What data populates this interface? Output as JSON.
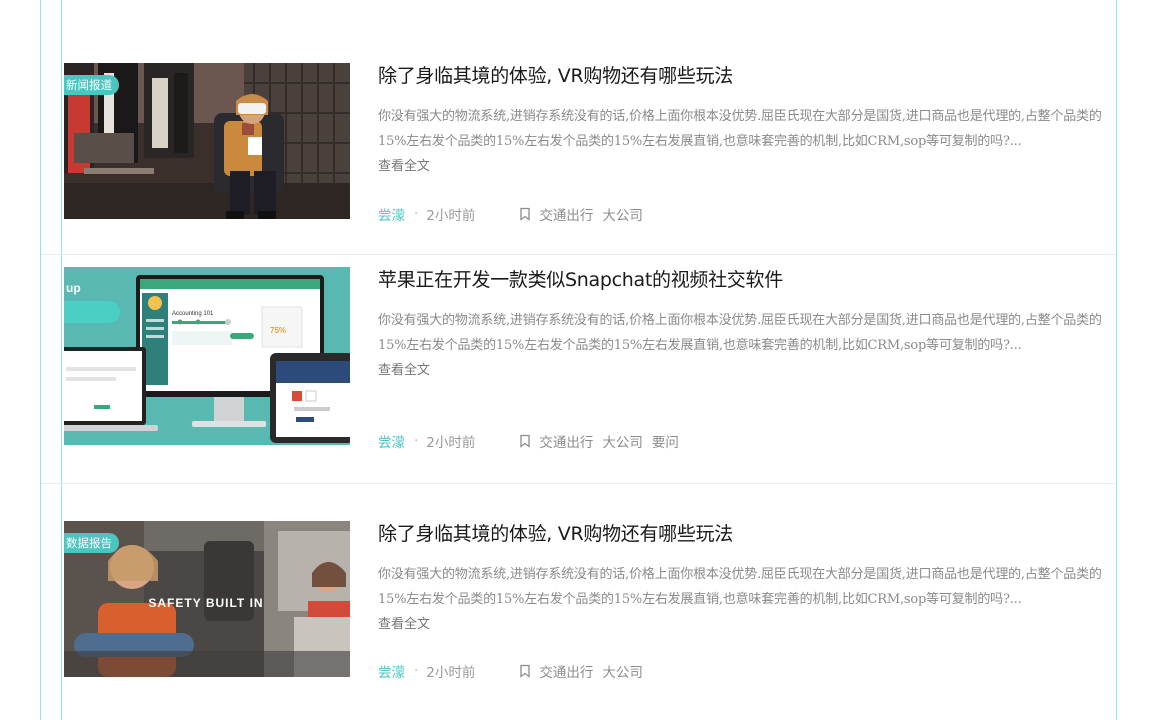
{
  "articles": [
    {
      "badge": "新闻报道",
      "title": "除了身临其境的体验, VR购物还有哪些玩法",
      "summary": "你没有强大的物流系统,进销存系统没有的话,价格上面你根本没优势.屈臣氏现在大部分是国货,进口商品也是代理的,占整个品类的15%左右发个品类的15%左右发个品类的15%左右发展直销,也意味套完善的机制,比如CRM,sop等可复制的吗?...",
      "read_more": "查看全文",
      "author": "尝濛",
      "time": "2小时前",
      "tags": [
        "交通出行",
        "大公司"
      ]
    },
    {
      "badge": "",
      "title": "苹果正在开发一款类似Snapchat的视频社交软件",
      "summary": "你没有强大的物流系统,进销存系统没有的话,价格上面你根本没优势.屈臣氏现在大部分是国货,进口商品也是代理的,占整个品类的15%左右发个品类的15%左右发个品类的15%左右发展直销,也意味套完善的机制,比如CRM,sop等可复制的吗?...",
      "read_more": "查看全文",
      "author": "尝濛",
      "time": "2小时前",
      "tags": [
        "交通出行",
        "大公司",
        "要问"
      ],
      "image_text": {
        "corner_label": "up",
        "screen_heading": "Accounting 101",
        "screen_value": "75%"
      }
    },
    {
      "badge": "数据报告",
      "title": "除了身临其境的体验, VR购物还有哪些玩法",
      "summary": "你没有强大的物流系统,进销存系统没有的话,价格上面你根本没优势.屈臣氏现在大部分是国货,进口商品也是代理的,占整个品类的15%左右发个品类的15%左右发个品类的15%左右发展直销,也意味套完善的机制,比如CRM,sop等可复制的吗?...",
      "read_more": "查看全文",
      "author": "尝濛",
      "time": "2小时前",
      "tags": [
        "交通出行",
        "大公司"
      ],
      "image_text": {
        "caption": "SAFETY BUILT IN"
      }
    }
  ],
  "colors": {
    "accent": "#4cc5c1",
    "guide_line": "#7fe3ea",
    "title": "#1a1a1a",
    "summary": "#8a8a8a",
    "meta": "#9a9a9a"
  },
  "icons": {
    "bookmark": "bookmark-icon"
  }
}
